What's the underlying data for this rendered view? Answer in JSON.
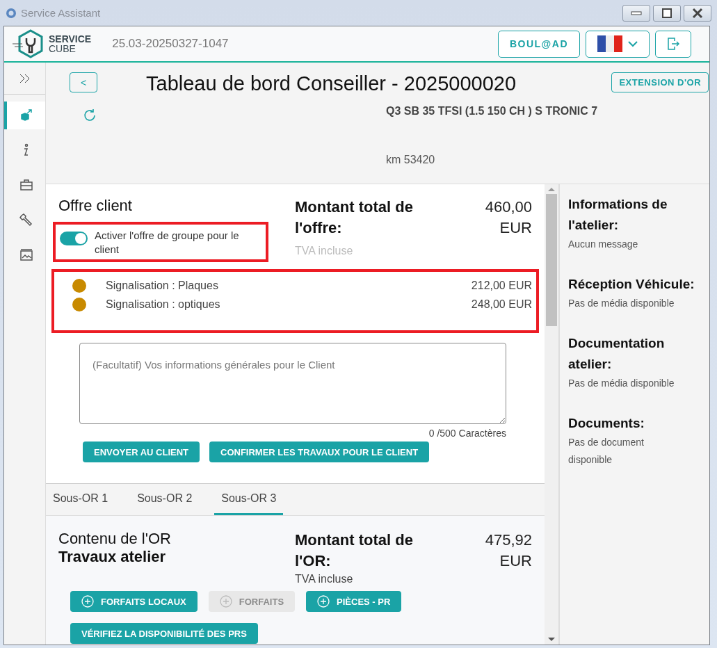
{
  "window": {
    "title": "Service Assistant"
  },
  "header": {
    "logo_top": "SERVICE",
    "logo_bottom": "CUBE",
    "version": "25.03-20250327-1047",
    "user_button": "BOUL@AD"
  },
  "sidebar": {
    "items": [
      {
        "kind": "package",
        "selected": true
      },
      {
        "kind": "info",
        "selected": false
      },
      {
        "kind": "toolbox",
        "selected": false
      },
      {
        "kind": "wrench",
        "selected": false
      },
      {
        "kind": "media",
        "selected": false
      }
    ]
  },
  "dashboard": {
    "back_button": "<",
    "title": "Tableau de bord Conseiller - 2025000020",
    "extension_button": "EXTENSION D'OR",
    "vehicle": "Q3 SB 35 TFSI (1.5 150 CH ) S TRONIC 7",
    "mileage": "km 53420"
  },
  "offer": {
    "title": "Offre client",
    "toggle": {
      "label": "Activer l'offre de groupe pour le client",
      "on": true
    },
    "total_label": "Montant total de l'offre:",
    "total_amount": "460,00",
    "total_currency": "EUR",
    "vat": "TVA incluse",
    "items": [
      {
        "label": "Signalisation : Plaques",
        "amount": "212,00 EUR",
        "color": "#c88a00"
      },
      {
        "label": "Signalisation : optiques",
        "amount": "248,00 EUR",
        "color": "#c88a00"
      }
    ],
    "notes_placeholder": "(Facultatif) Vos informations générales pour le Client",
    "char_count": "0 /500 Caractères",
    "buttons": [
      "ENVOYER AU CLIENT",
      "CONFIRMER LES TRAVAUX POUR LE CLIENT"
    ]
  },
  "tabs": [
    {
      "label": "Sous-OR 1",
      "selected": false
    },
    {
      "label": "Sous-OR 2",
      "selected": false
    },
    {
      "label": "Sous-OR 3",
      "selected": true
    }
  ],
  "or_content": {
    "title": "Contenu de l'OR",
    "subtitle": "Travaux atelier",
    "total_label": "Montant total de l'OR:",
    "total_amount": "475,92",
    "total_currency": "EUR",
    "vat": "TVA incluse",
    "buttons": [
      {
        "label": "FORFAITS LOCAUX",
        "kind": "add",
        "disabled": false
      },
      {
        "label": "FORFAITS",
        "kind": "add",
        "disabled": true
      },
      {
        "label": "PIÈCES - PR",
        "kind": "add",
        "disabled": false
      },
      {
        "label": "VÉRIFIEZ LA DISPONIBILITÉ DES PRS",
        "kind": "plain",
        "disabled": false
      }
    ]
  },
  "info_panel": [
    {
      "title": "Informations de l'atelier:",
      "text": "Aucun message"
    },
    {
      "title": "Réception Véhicule:",
      "text": "Pas de média disponible"
    },
    {
      "title": "Documentation atelier:",
      "text": "Pas de média disponible"
    },
    {
      "title": "Documents:",
      "text": "Pas de document disponible"
    }
  ]
}
